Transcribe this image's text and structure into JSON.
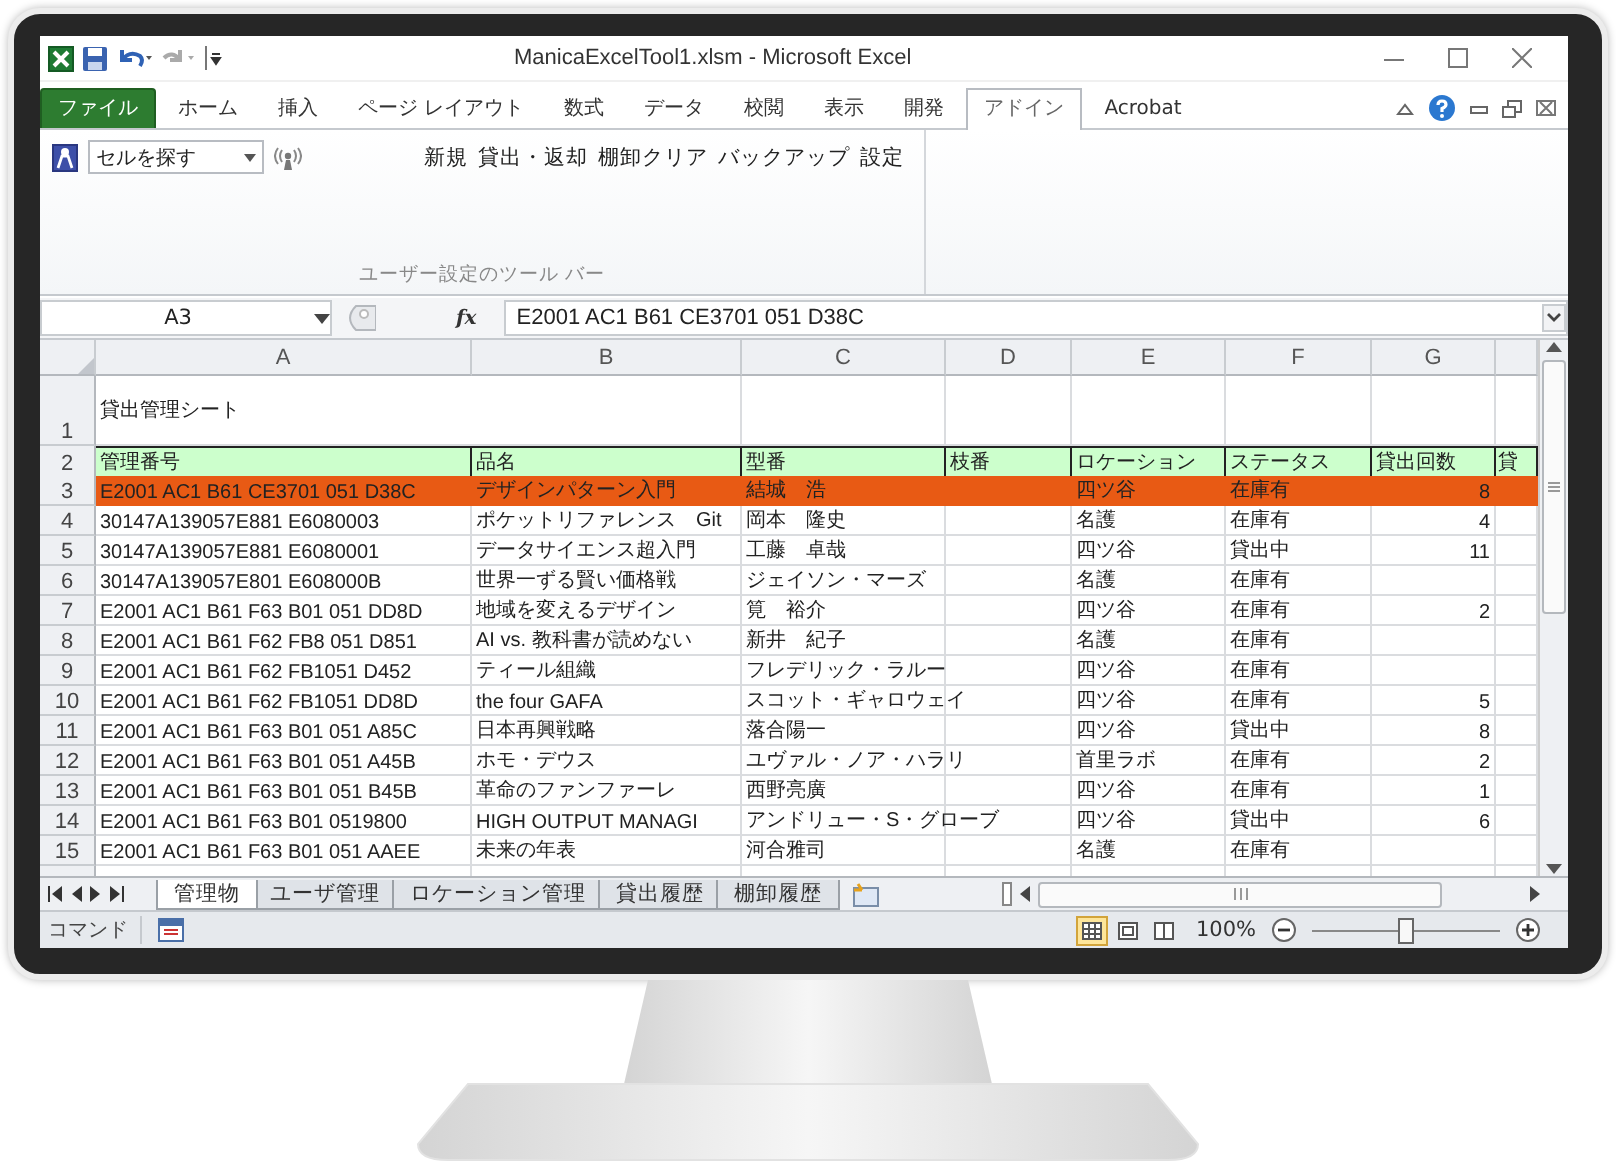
{
  "window": {
    "title": "ManicaExcelTool1.xlsm  -  Microsoft Excel"
  },
  "ribbon_tabs": [
    {
      "label": "ファイル",
      "kind": "file",
      "selected": false
    },
    {
      "label": "ホーム",
      "kind": "tab",
      "selected": false
    },
    {
      "label": "挿入",
      "kind": "tab",
      "selected": false
    },
    {
      "label": "ページ レイアウト",
      "kind": "tab",
      "selected": false
    },
    {
      "label": "数式",
      "kind": "tab",
      "selected": false
    },
    {
      "label": "データ",
      "kind": "tab",
      "selected": false
    },
    {
      "label": "校閲",
      "kind": "tab",
      "selected": false
    },
    {
      "label": "表示",
      "kind": "tab",
      "selected": false
    },
    {
      "label": "開発",
      "kind": "tab",
      "selected": false
    },
    {
      "label": "アドイン",
      "kind": "tab",
      "selected": true
    },
    {
      "label": "Acrobat",
      "kind": "tab",
      "selected": false
    }
  ],
  "toolbar": {
    "dropdown": {
      "value": "セルを探す"
    },
    "commands": [
      "新規",
      "貸出・返却",
      "棚卸クリア",
      "バックアップ",
      "設定"
    ],
    "group_label": "ユーザー設定のツール バー"
  },
  "formula_bar": {
    "name_box": "A3",
    "function_label": "fx",
    "formula": "E2001 AC1 B61 CE3701 051 D38C"
  },
  "columns": [
    "A",
    "B",
    "C",
    "D",
    "E",
    "F",
    "G"
  ],
  "title_row": {
    "number": "1",
    "text": "貸出管理シート"
  },
  "header_row": {
    "number": "2",
    "cells": [
      "管理番号",
      "品名",
      "型番",
      "枝番",
      "ロケーション",
      "ステータス",
      "貸出回数",
      "貸"
    ]
  },
  "rows": [
    {
      "number": "3",
      "selected": true,
      "cells": {
        "A": "E2001 AC1 B61 CE3701 051 D38C",
        "B": "デザインパターン入門",
        "C": "結城　浩",
        "E": "四ツ谷",
        "F": "在庫有",
        "G": "8"
      }
    },
    {
      "number": "4",
      "selected": false,
      "cells": {
        "A": "30147A139057E881 E6080003",
        "B": "ポケットリファレンス　Git",
        "C": "岡本　隆史",
        "E": "名護",
        "F": "在庫有",
        "G": "4"
      }
    },
    {
      "number": "5",
      "selected": false,
      "cells": {
        "A": "30147A139057E881 E6080001",
        "B": "データサイエンス超入門",
        "C": "工藤　卓哉",
        "E": "四ツ谷",
        "F": "貸出中",
        "G": "11"
      }
    },
    {
      "number": "6",
      "selected": false,
      "cells": {
        "A": "30147A139057E801 E608000B",
        "B": "世界一ずる賢い価格戦",
        "C": "ジェイソン・マーズ",
        "E": "名護",
        "F": "在庫有"
      }
    },
    {
      "number": "7",
      "selected": false,
      "cells": {
        "A": "E2001 AC1 B61 F63 B01 051 DD8D",
        "B": "地域を変えるデザイン",
        "C": "筧　裕介",
        "E": "四ツ谷",
        "F": "在庫有",
        "G": "2"
      }
    },
    {
      "number": "8",
      "selected": false,
      "cells": {
        "A": "E2001 AC1 B61 F62 FB8 051 D851",
        "B": "AI vs. 教科書が読めない",
        "C": "新井　紀子",
        "E": "名護",
        "F": "在庫有"
      }
    },
    {
      "number": "9",
      "selected": false,
      "cells": {
        "A": "E2001 AC1 B61 F62 FB1051 D452",
        "B": "ティール組織",
        "C": "フレデリック・ラルー",
        "E": "四ツ谷",
        "F": "在庫有"
      }
    },
    {
      "number": "10",
      "selected": false,
      "cells": {
        "A": "E2001 AC1 B61 F62 FB1051 DD8D",
        "B": "the four GAFA",
        "C": "スコット・ギャロウェイ",
        "E": "四ツ谷",
        "F": "在庫有",
        "G": "5"
      }
    },
    {
      "number": "11",
      "selected": false,
      "cells": {
        "A": "E2001 AC1 B61 F63 B01 051 A85C",
        "B": "日本再興戦略",
        "C": "落合陽一",
        "E": "四ツ谷",
        "F": "貸出中",
        "G": "8"
      }
    },
    {
      "number": "12",
      "selected": false,
      "cells": {
        "A": "E2001 AC1 B61 F63 B01 051 A45B",
        "B": "ホモ・デウス",
        "C": "ユヴァル・ノア・ハラリ",
        "E": "首里ラボ",
        "F": "在庫有",
        "G": "2"
      }
    },
    {
      "number": "13",
      "selected": false,
      "cells": {
        "A": "E2001 AC1 B61 F63 B01 051 B45B",
        "B": "革命のファンファーレ",
        "C": "西野亮廣",
        "E": "四ツ谷",
        "F": "在庫有",
        "G": "1"
      }
    },
    {
      "number": "14",
      "selected": false,
      "cells": {
        "A": "E2001 AC1 B61 F63 B01 0519800",
        "B": "HIGH OUTPUT MANAGI",
        "C": "アンドリュー・S・グローブ",
        "E": "四ツ谷",
        "F": "貸出中",
        "G": "6"
      }
    },
    {
      "number": "15",
      "selected": false,
      "cells": {
        "A": "E2001 AC1 B61 F63 B01 051 AAEE",
        "B": "未来の年表",
        "C": "河合雅司",
        "E": "名護",
        "F": "在庫有"
      }
    }
  ],
  "sheet_tabs": [
    {
      "label": "管理物",
      "selected": true
    },
    {
      "label": "ユーザ管理",
      "selected": false
    },
    {
      "label": "ロケーション管理",
      "selected": false
    },
    {
      "label": "貸出履歴",
      "selected": false
    },
    {
      "label": "棚卸履歴",
      "selected": false
    }
  ],
  "status_bar": {
    "mode": "コマンド",
    "zoom": "100%",
    "zoom_slider": {
      "level": 0.5
    }
  }
}
